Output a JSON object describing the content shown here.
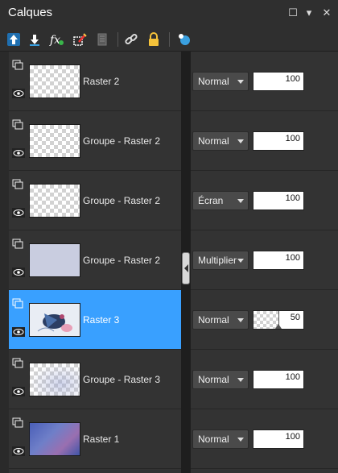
{
  "panel": {
    "title": "Calques"
  },
  "window_controls": [
    {
      "name": "restore-icon",
      "glyph": "☐"
    },
    {
      "name": "menu-dropdown-icon",
      "glyph": "▾"
    },
    {
      "name": "close-icon",
      "glyph": "✕"
    }
  ],
  "toolbar": {
    "buttons": [
      {
        "name": "move-layer-up-icon"
      },
      {
        "name": "move-layer-down-icon"
      },
      {
        "name": "layer-effects-icon"
      },
      {
        "name": "edit-selection-icon"
      },
      {
        "name": "delete-layer-icon"
      },
      {
        "name": "link-layers-icon"
      },
      {
        "name": "lock-icon"
      },
      {
        "name": "layer-properties-icon"
      }
    ]
  },
  "layers": [
    {
      "name": "Raster 2",
      "blend": "Normal",
      "opacity": 100,
      "selected": false,
      "thumb": "empty"
    },
    {
      "name": "Groupe - Raster 2",
      "blend": "Normal",
      "opacity": 100,
      "selected": false,
      "thumb": "empty"
    },
    {
      "name": "Groupe - Raster 2",
      "blend": "Écran",
      "opacity": 100,
      "selected": false,
      "thumb": "empty"
    },
    {
      "name": "Groupe - Raster 2",
      "blend": "Multiplier",
      "opacity": 100,
      "selected": false,
      "thumb": "bluish"
    },
    {
      "name": "Raster 3",
      "blend": "Normal",
      "opacity": 50,
      "selected": true,
      "thumb": "bird"
    },
    {
      "name": "Groupe - Raster 3",
      "blend": "Normal",
      "opacity": 100,
      "selected": false,
      "thumb": "faint"
    },
    {
      "name": "Raster 1",
      "blend": "Normal",
      "opacity": 100,
      "selected": false,
      "thumb": "blue"
    }
  ],
  "colors": {
    "selection": "#39a0ff",
    "accent_icon": "#3aa0e0"
  }
}
